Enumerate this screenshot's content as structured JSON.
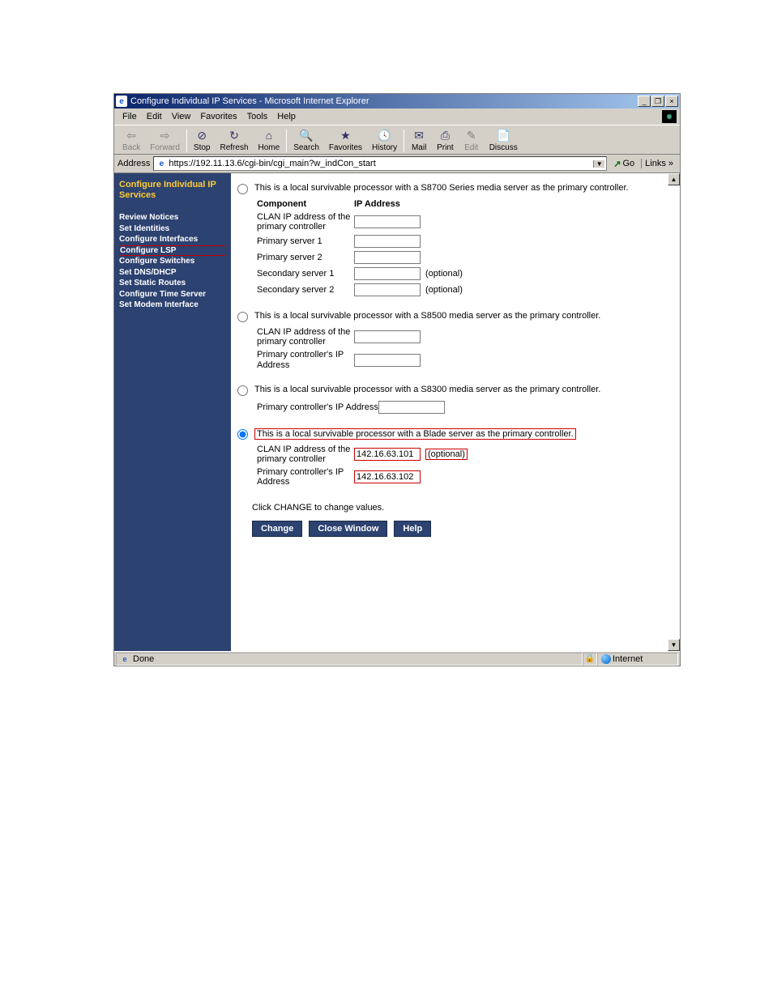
{
  "titlebar": {
    "text": "Configure Individual IP Services - Microsoft Internet Explorer"
  },
  "menubar": {
    "file": "File",
    "edit": "Edit",
    "view": "View",
    "favorites": "Favorites",
    "tools": "Tools",
    "help": "Help"
  },
  "toolbar": {
    "back": "Back",
    "forward": "Forward",
    "stop": "Stop",
    "refresh": "Refresh",
    "home": "Home",
    "search": "Search",
    "favorites": "Favorites",
    "history": "History",
    "mail": "Mail",
    "print": "Print",
    "edit": "Edit",
    "discuss": "Discuss"
  },
  "addrbar": {
    "label": "Address",
    "url": "https://192.11.13.6/cgi-bin/cgi_main?w_indCon_start",
    "go": "Go",
    "links": "Links »"
  },
  "sidebar": {
    "title": "Configure Individual IP Services",
    "items": [
      "Review Notices",
      "Set Identities",
      "Configure Interfaces",
      "Configure LSP",
      "Configure Switches",
      "Set DNS/DHCP",
      "Set Static Routes",
      "Configure Time Server",
      "Set Modem Interface"
    ]
  },
  "options": {
    "s8700": "This is a local survivable processor with a S8700 Series media server as the primary controller.",
    "s8500": "This is a local survivable processor with a S8500 media server as the primary controller.",
    "s8300": "This is a local survivable processor with a S8300 media server as the primary controller.",
    "blade": "This is a local survivable processor with a Blade server as the primary controller."
  },
  "headers": {
    "component": "Component",
    "ip": "IP Address"
  },
  "labels": {
    "clan": "CLAN IP address of the primary controller",
    "ps1": "Primary server 1",
    "ps2": "Primary server 2",
    "ss1": "Secondary server 1",
    "ss2": "Secondary server 2",
    "pcip": "Primary controller's IP Address",
    "optional": "(optional)"
  },
  "values": {
    "blade_clan": "142.16.63.101",
    "blade_pcip": "142.16.63.102"
  },
  "instr": "Click CHANGE to change values.",
  "buttons": {
    "change": "Change",
    "close": "Close Window",
    "help": "Help"
  },
  "statusbar": {
    "done": "Done",
    "zone": "Internet"
  }
}
